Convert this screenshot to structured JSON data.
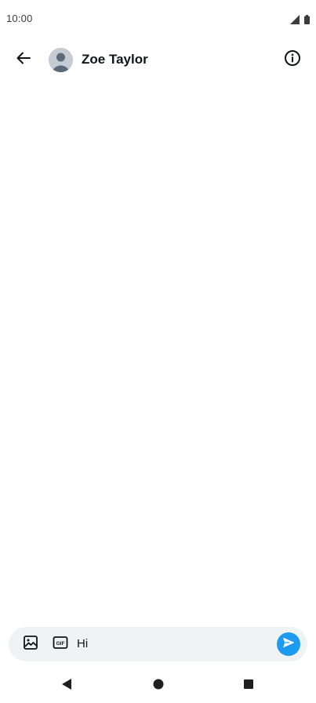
{
  "status_bar": {
    "time": "10:00",
    "icons": [
      "signal-icon",
      "battery-icon"
    ]
  },
  "header": {
    "back_icon": "arrow-left-icon",
    "contact_name": "Zoe Taylor",
    "avatar_icon": "default-avatar-icon",
    "info_icon": "info-icon"
  },
  "composer": {
    "media_icon": "image-icon",
    "gif_icon": "gif-icon",
    "gif_label": "GIF",
    "input_value": "Hi",
    "send_icon": "send-icon"
  },
  "nav_bar": {
    "icons": [
      "nav-back-icon",
      "nav-home-icon",
      "nav-recents-icon"
    ]
  },
  "colors": {
    "accent": "#1d9bf0",
    "composer_bg": "#eff3f4",
    "text": "#0f1419",
    "nav_icon": "#1f1f1f"
  }
}
